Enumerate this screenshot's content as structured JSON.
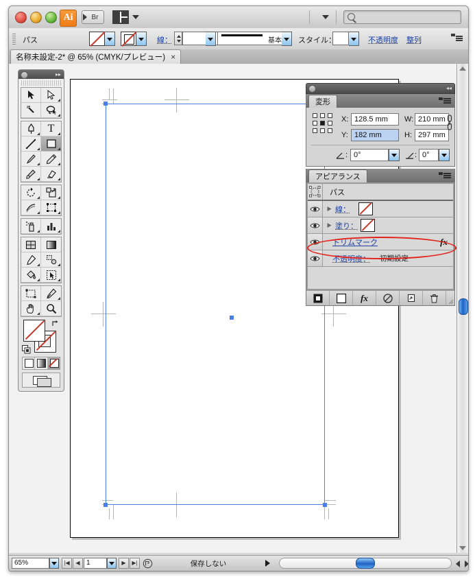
{
  "app": {
    "name": "Adobe Illustrator",
    "logo_text": "Ai",
    "bridge_label": "Br",
    "arrange_icon": "arrange-documents-icon",
    "search_placeholder": ""
  },
  "window_controls": {
    "close": "close-window-button",
    "minimize": "minimize-window-button",
    "zoom": "zoom-window-button"
  },
  "control_bar": {
    "object_label": "パス",
    "fill_swatch_label": "fill-swatch",
    "stroke_swatch_label": "stroke-swatch",
    "stroke_label": "線：",
    "stroke_weight_value": "",
    "profile_label": "基本",
    "style_label": "スタイル：",
    "opacity_label": "不透明度",
    "align_label": "整列"
  },
  "document_tab": {
    "title": "名称未設定-2* @ 65% (CMYK/プレビュー)",
    "close_glyph": "×"
  },
  "toolbox": {
    "tools": [
      {
        "name": "selection-tool",
        "glyph": "arrow"
      },
      {
        "name": "direct-selection-tool",
        "glyph": "arrow-white"
      },
      {
        "name": "magic-wand-tool",
        "glyph": "wand"
      },
      {
        "name": "lasso-tool",
        "glyph": "lasso"
      },
      {
        "name": "pen-tool",
        "glyph": "pen"
      },
      {
        "name": "type-tool",
        "glyph": "T"
      },
      {
        "name": "line-segment-tool",
        "glyph": "line"
      },
      {
        "name": "rectangle-tool",
        "glyph": "rect"
      },
      {
        "name": "paintbrush-tool",
        "glyph": "brush"
      },
      {
        "name": "pencil-tool",
        "glyph": "pencil"
      },
      {
        "name": "blob-brush-tool",
        "glyph": "blob"
      },
      {
        "name": "eraser-tool",
        "glyph": "eraser"
      },
      {
        "name": "rotate-tool",
        "glyph": "rotate"
      },
      {
        "name": "scale-tool",
        "glyph": "scale"
      },
      {
        "name": "width-tool",
        "glyph": "warp"
      },
      {
        "name": "free-transform-tool",
        "glyph": "free-transform"
      },
      {
        "name": "symbol-sprayer-tool",
        "glyph": "sprayer"
      },
      {
        "name": "column-graph-tool",
        "glyph": "graph"
      },
      {
        "name": "mesh-tool",
        "glyph": "mesh"
      },
      {
        "name": "gradient-tool",
        "glyph": "gradient"
      },
      {
        "name": "eyedropper-tool",
        "glyph": "eyedropper"
      },
      {
        "name": "blend-tool",
        "glyph": "blend"
      },
      {
        "name": "live-paint-bucket-tool",
        "glyph": "bucket"
      },
      {
        "name": "live-paint-selection-tool",
        "glyph": "paint-select"
      },
      {
        "name": "artboard-tool",
        "glyph": "artboard"
      },
      {
        "name": "slice-tool",
        "glyph": "knife"
      },
      {
        "name": "hand-tool",
        "glyph": "hand"
      },
      {
        "name": "zoom-tool",
        "glyph": "magnifier"
      }
    ],
    "fill_stroke": {
      "fill_name": "fill-color-none",
      "stroke_name": "stroke-color-none",
      "swap_name": "swap-fill-stroke-icon",
      "default_name": "default-fill-stroke-icon"
    },
    "color_modes": [
      "color-mode-button",
      "gradient-mode-button",
      "none-mode-button"
    ],
    "screen_mode": "screen-mode-button"
  },
  "transform_panel": {
    "tab_label": "変形",
    "reference_point": "reference-point-selector",
    "fields": [
      {
        "label": "X:",
        "value": "128.5 mm",
        "highlighted": false
      },
      {
        "label": "Y:",
        "value": "182 mm",
        "highlighted": true
      },
      {
        "label": "W:",
        "value": "210 mm",
        "highlighted": false
      },
      {
        "label": "H:",
        "value": "297 mm",
        "highlighted": false
      }
    ],
    "shear_angle": "0°",
    "rotate_angle": "0°",
    "constrain_icon": "link-proportions-icon"
  },
  "appearance_panel": {
    "tab_label": "アピアランス",
    "target_label": "パス",
    "rows": [
      {
        "name": "stroke-row",
        "label": "線：",
        "kind": "swatch",
        "visible": true,
        "expandable": true,
        "link": true
      },
      {
        "name": "fill-row",
        "label": "塗り：",
        "kind": "swatch",
        "visible": true,
        "expandable": true,
        "link": true
      },
      {
        "name": "effect-row",
        "label": "トリムマーク",
        "kind": "fx",
        "visible": true,
        "expandable": false,
        "link": true,
        "highlighted": true
      },
      {
        "name": "opacity-row",
        "label": "不透明度：",
        "kind": "value",
        "visible": true,
        "expandable": false,
        "link": true,
        "value": "初期設定"
      }
    ],
    "footer_buttons": [
      {
        "name": "add-new-stroke-button",
        "glyph": "stroke-square"
      },
      {
        "name": "add-new-fill-button",
        "glyph": "fill-square"
      },
      {
        "name": "add-new-effect-button",
        "glyph": "fx"
      },
      {
        "name": "clear-appearance-button",
        "glyph": "no-symbol"
      },
      {
        "name": "duplicate-item-button",
        "glyph": "duplicate"
      },
      {
        "name": "delete-item-button",
        "glyph": "trash"
      }
    ]
  },
  "canvas": {
    "artboard_name": "artboard",
    "selection_name": "selected-path-bounding-box",
    "trim_marks_name": "trim-marks",
    "registration_marks_name": "registration-marks",
    "center_point_name": "center-anchor-point"
  },
  "status_bar": {
    "zoom_value": "65%",
    "page_value": "1",
    "status_text": "保存しない",
    "first_page_glyph": "|◀",
    "prev_page_glyph": "◀",
    "next_page_glyph": "▶",
    "last_page_glyph": "▶|",
    "artboard_nav_icon": "artboard-navigation-icon"
  },
  "colors": {
    "selection_blue": "#4a7fe8",
    "highlight_red": "#e32219",
    "link_blue": "#1b3fa0",
    "trim_mark_gray": "#b5b5b5",
    "panel_gray": "#d4d4d4"
  }
}
